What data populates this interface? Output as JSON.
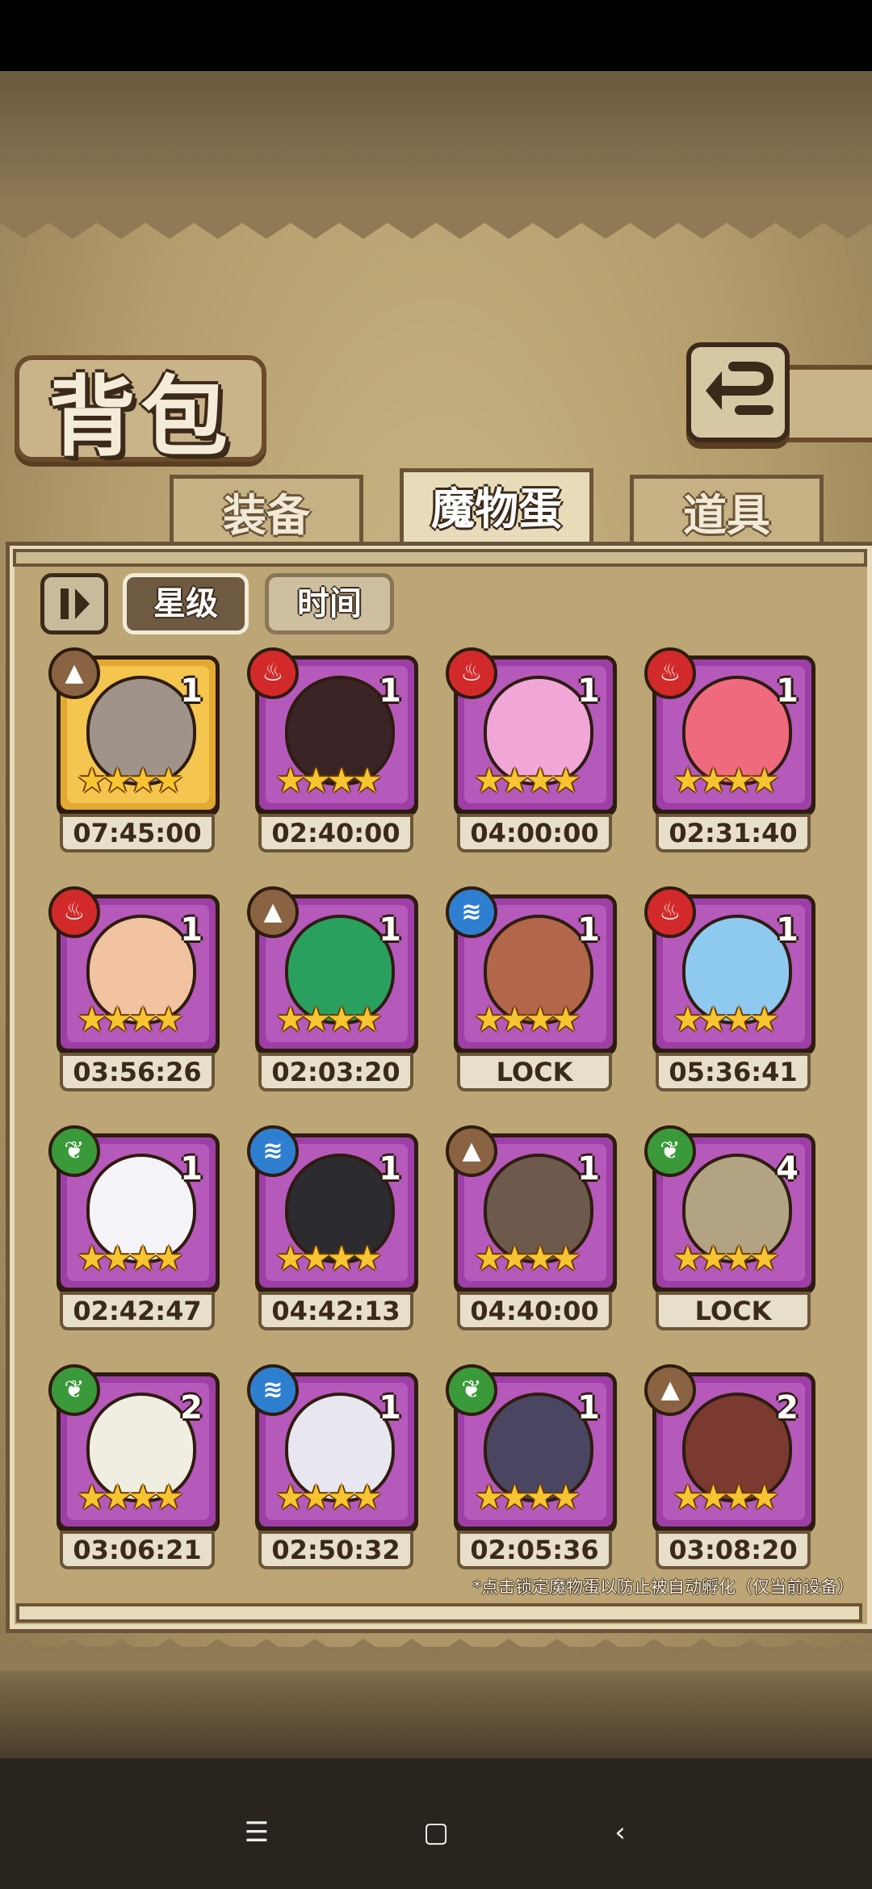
{
  "header": {
    "title": "背包"
  },
  "tabs": [
    {
      "label": "装备",
      "active": false
    },
    {
      "label": "魔物蛋",
      "active": true
    },
    {
      "label": "道具",
      "active": false
    }
  ],
  "controls": {
    "pause_icon": "pause-icon",
    "sort_star_label": "星级",
    "sort_time_label": "时间"
  },
  "eggs": [
    {
      "element": "earth",
      "count": "1",
      "timer": "07:45:00",
      "rarity": "gold",
      "color": "#a0938a"
    },
    {
      "element": "fire",
      "count": "1",
      "timer": "02:40:00",
      "rarity": "purple",
      "color": "#3a2426"
    },
    {
      "element": "fire",
      "count": "1",
      "timer": "04:00:00",
      "rarity": "purple",
      "color": "#f1a6d8"
    },
    {
      "element": "fire",
      "count": "1",
      "timer": "02:31:40",
      "rarity": "purple",
      "color": "#f06a7e"
    },
    {
      "element": "fire",
      "count": "1",
      "timer": "03:56:26",
      "rarity": "purple",
      "color": "#f1c3a0"
    },
    {
      "element": "earth",
      "count": "1",
      "timer": "02:03:20",
      "rarity": "purple",
      "color": "#2aa05e"
    },
    {
      "element": "water",
      "count": "1",
      "timer": "LOCK",
      "rarity": "purple",
      "color": "#b2664a"
    },
    {
      "element": "fire",
      "count": "1",
      "timer": "05:36:41",
      "rarity": "purple",
      "color": "#8ec9f0"
    },
    {
      "element": "grass",
      "count": "1",
      "timer": "02:42:47",
      "rarity": "purple",
      "color": "#f4f4f8"
    },
    {
      "element": "water",
      "count": "1",
      "timer": "04:42:13",
      "rarity": "purple",
      "color": "#2b2b30"
    },
    {
      "element": "earth",
      "count": "1",
      "timer": "04:40:00",
      "rarity": "purple",
      "color": "#6e5a4c"
    },
    {
      "element": "grass",
      "count": "4",
      "timer": "LOCK",
      "rarity": "purple",
      "color": "#b2a483"
    },
    {
      "element": "grass",
      "count": "2",
      "timer": "03:06:21",
      "rarity": "purple",
      "color": "#f0eee0"
    },
    {
      "element": "water",
      "count": "1",
      "timer": "02:50:32",
      "rarity": "purple",
      "color": "#e8e6ee"
    },
    {
      "element": "grass",
      "count": "1",
      "timer": "02:05:36",
      "rarity": "purple",
      "color": "#4a4560"
    },
    {
      "element": "earth",
      "count": "2",
      "timer": "03:08:20",
      "rarity": "purple",
      "color": "#7a3a30"
    }
  ],
  "stars_per_egg": 4,
  "footer_note": "*点击锁定魔物蛋以防止被自动孵化（仅当前设备）",
  "nav": {
    "menu_icon": "menu-icon",
    "home_icon": "home-icon",
    "back_icon": "back-icon"
  }
}
